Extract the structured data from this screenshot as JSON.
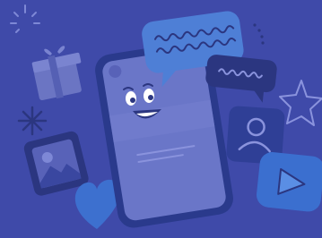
{
  "illustration": {
    "elements": [
      "sparkle-burst-icon",
      "gift-icon",
      "asterisk-sparkle-icon",
      "photo-frame-icon",
      "heart-icon",
      "smartphone",
      "smiling-face",
      "chat-bubble-wavy",
      "chat-bubble-small-wavy",
      "profile-card-icon",
      "play-button-icon",
      "star-outline-icon"
    ]
  },
  "colors": {
    "background": "#3f4aa9",
    "dark_navy": "#2b3680",
    "phone_screen": "#6a76c8",
    "phone_frame": "#2a3a8c",
    "light_blue": "#4e7fd6",
    "mid_purple": "#5862b8",
    "gift": "#6b75c3",
    "heart": "#3d70cf",
    "play_tile": "#3b6fcf",
    "profile_tile": "#2f3f96",
    "outline_light": "#8a93dd"
  }
}
